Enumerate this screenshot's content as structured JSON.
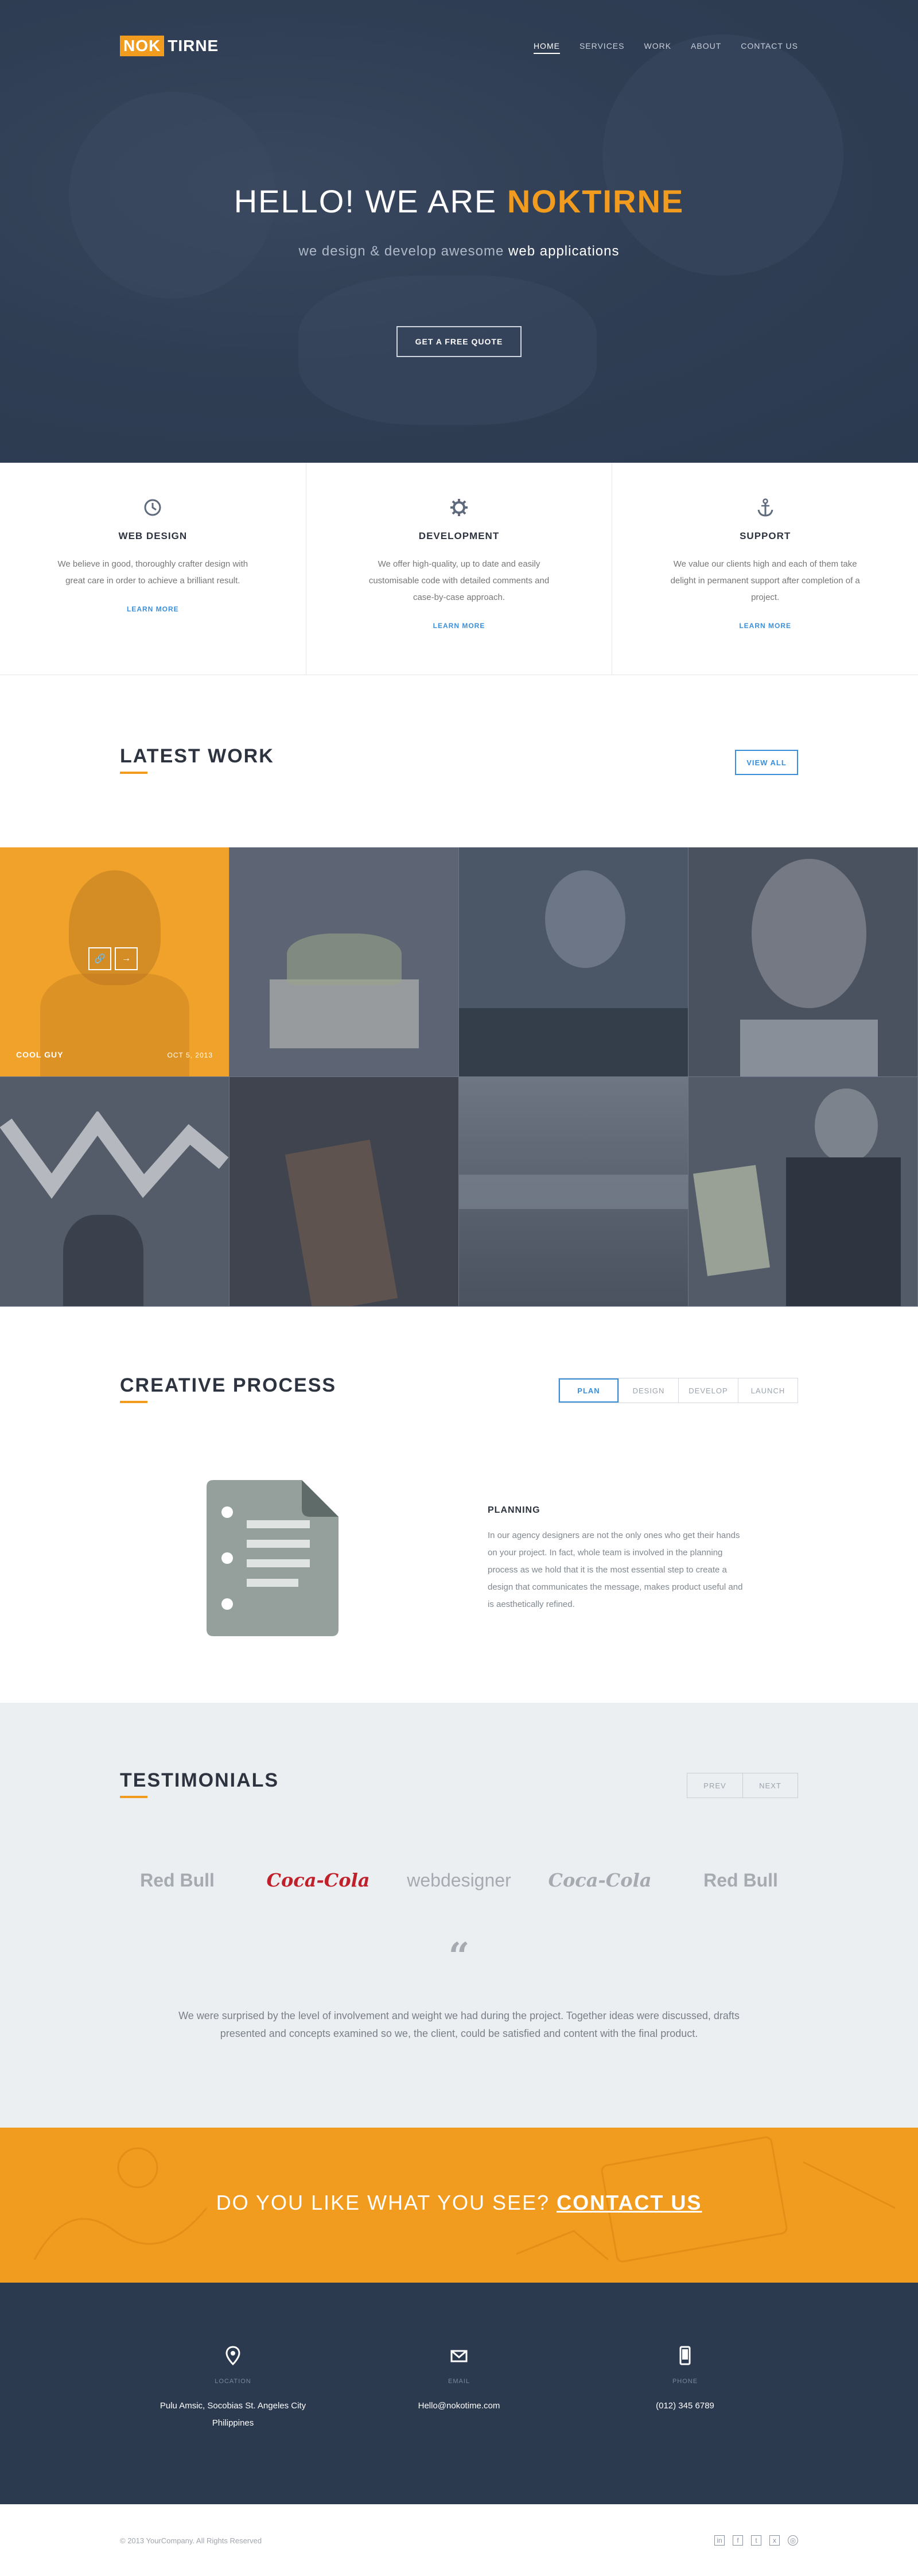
{
  "brand": {
    "logo_highlight": "NOK",
    "logo_rest": "TIRNE",
    "accent": "#f29c1f",
    "link_blue": "#3b8fd9",
    "navy": "#2c3a50"
  },
  "nav": {
    "items": [
      "HOME",
      "SERVICES",
      "WORK",
      "ABOUT",
      "CONTACT US"
    ],
    "active": "HOME"
  },
  "hero": {
    "title_prefix": "HELLO! WE ARE ",
    "title_brand": "NOKTIRNE",
    "subtitle_prefix": "we design & develop awesome ",
    "subtitle_strong": "web applications",
    "cta": "GET A FREE QUOTE"
  },
  "services": [
    {
      "icon": "clock-icon",
      "title": "WEB DESIGN",
      "text": "We believe in good, thoroughly crafter design with great care in order to achieve a brilliant result.",
      "link": "LEARN MORE"
    },
    {
      "icon": "gear-icon",
      "title": "DEVELOPMENT",
      "text": "We offer high-quality, up to date and easily customisable code with detailed comments and case-by-case approach.",
      "link": "LEARN MORE"
    },
    {
      "icon": "anchor-icon",
      "title": "SUPPORT",
      "text": "We value our clients high and each of them take delight in permanent support after completion of a project.",
      "link": "LEARN MORE"
    }
  ],
  "latest_work": {
    "title": "LATEST WORK",
    "view_all": "VIEW ALL",
    "featured": {
      "caption": "COOL GUY",
      "date": "OCT 5, 2013"
    }
  },
  "process": {
    "title": "CREATIVE PROCESS",
    "tabs": [
      "PLAN",
      "DESIGN",
      "DEVELOP",
      "LAUNCH"
    ],
    "active_tab": "PLAN",
    "step_title": "PLANNING",
    "step_text": "In our agency designers are not the only ones who get their hands on your project. In fact, whole team is involved in the planning process as we hold that it is the most essential step to create a design that communicates the message, makes product useful and is aesthetically refined."
  },
  "testimonials": {
    "title": "TESTIMONIALS",
    "prev": "PREV",
    "next": "NEXT",
    "logos": [
      "Red Bull",
      "Coca-Cola",
      "webdesigner",
      "Coca-Cola",
      "Red Bull"
    ],
    "quote_mark": "“",
    "quote": "We were surprised by the level of involvement and weight we had during the project. Together ideas were discussed, drafts presented and concepts examined so we, the client, could be satisfied and content with the final product."
  },
  "cta": {
    "prefix": "DO YOU LIKE WHAT YOU SEE? ",
    "link": "CONTACT US"
  },
  "contact": [
    {
      "icon": "location-pin-icon",
      "label": "LOCATION",
      "value_line1": "Pulu Amsic, Socobias St. Angeles City",
      "value_line2": "Philippines"
    },
    {
      "icon": "envelope-icon",
      "label": "EMAIL",
      "value_line1": "Hello@nokotime.com",
      "value_line2": ""
    },
    {
      "icon": "phone-icon",
      "label": "PHONE",
      "value_line1": "(012) 345 6789",
      "value_line2": ""
    }
  ],
  "footer": {
    "copyright": "© 2013 YourCompany. All Rights Reserved",
    "socials": [
      "linkedin-icon",
      "facebook-icon",
      "twitter-icon",
      "xing-icon",
      "dribbble-icon"
    ]
  }
}
